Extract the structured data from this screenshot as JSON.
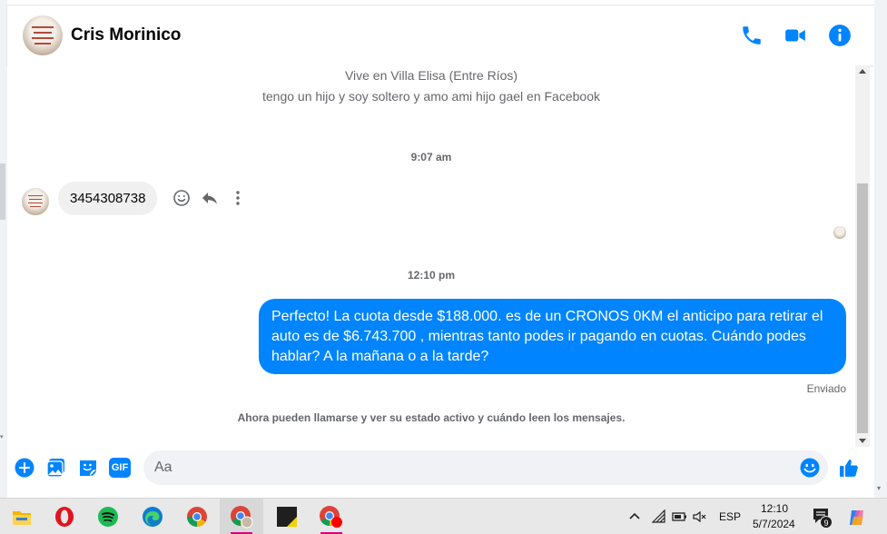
{
  "header": {
    "contact_name": "Cris Morinico",
    "icons": [
      "phone-icon",
      "video-camera-icon",
      "info-icon"
    ],
    "accent": "#0084ff"
  },
  "profile_info": {
    "location": "Vive en Villa Elisa (Entre Ríos)",
    "bio": "tengo un hijo y soy soltero y amo ami hijo gael en Facebook"
  },
  "messages": [
    {
      "time": "9:07 am",
      "direction": "incoming",
      "text": "3454308738"
    },
    {
      "time": "12:10 pm",
      "direction": "outgoing",
      "text": "Perfecto! La cuota desde $188.000. es de un CRONOS 0KM el anticipo para retirar el auto es de $6.743.700 , mientras tanto podes ir pagando en cuotas. Cuándo podes hablar? A la mañana o a la tarde?",
      "status": "Enviado"
    }
  ],
  "info_note": "Ahora pueden llamarse y ver su estado activo y cuándo leen los mensajes.",
  "composer": {
    "placeholder": "Aa",
    "value": "",
    "icons": [
      "plus-icon",
      "image-icon",
      "sticker-icon",
      "gif-icon",
      "emoji-icon",
      "like-icon"
    ],
    "gif_label": "GIF"
  },
  "taskbar": {
    "apps": [
      "file-explorer-icon",
      "opera-icon",
      "spotify-icon",
      "edge-icon",
      "chrome-icon",
      "chrome-profile-icon",
      "sticky-notes-icon",
      "chrome-record-icon"
    ],
    "tray": {
      "language": "ESP",
      "time": "12:10",
      "date": "5/7/2024",
      "notifications": "9"
    }
  }
}
